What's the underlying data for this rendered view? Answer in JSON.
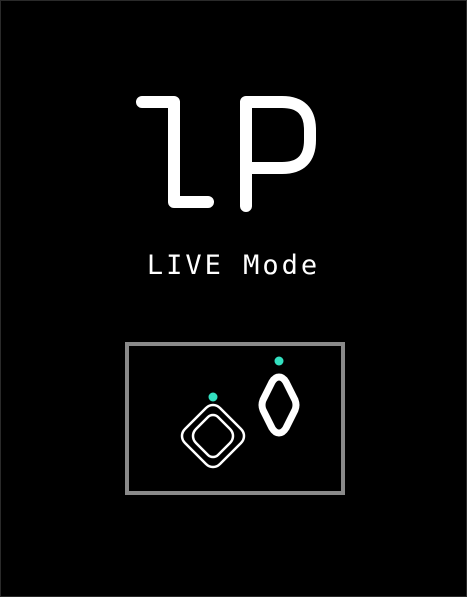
{
  "screen": {
    "player_indicator": "1P",
    "mode_label": "LIVE Mode"
  },
  "device_illustration": {
    "status_led_color": "#33e0c0",
    "outline_color": "#ffffff",
    "box_border_color": "#8a8a8a",
    "left_controller_icon": "rounded-square-controller-icon",
    "right_controller_icon": "diamond-controller-icon"
  }
}
